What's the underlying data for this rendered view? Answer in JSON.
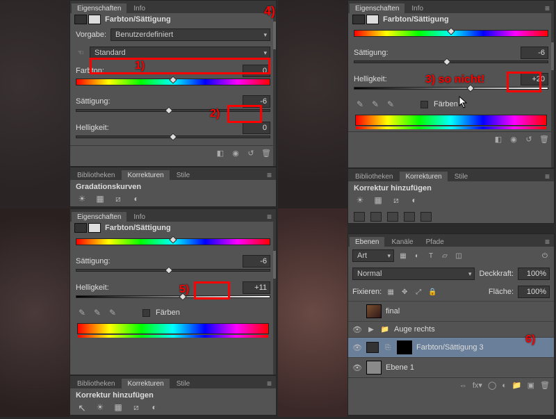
{
  "annotations": {
    "a1": "1)",
    "a2": "2)",
    "a3": "3) so nicht!",
    "a4": "4)",
    "a5": "5)",
    "a6": "6)"
  },
  "tabs": {
    "eigenschaften": "Eigenschaften",
    "info": "Info",
    "bibliotheken": "Bibliotheken",
    "korrekturen": "Korrekturen",
    "stile": "Stile",
    "ebenen": "Ebenen",
    "kanaele": "Kanäle",
    "pfade": "Pfade"
  },
  "hs": {
    "title": "Farbton/Sättigung",
    "preset_label": "Vorgabe:",
    "preset_value": "Benutzerdefiniert",
    "range_value": "Standard",
    "hue_label": "Farbton:",
    "sat_label": "Sättigung:",
    "light_label": "Helligkeit:",
    "colorize": "Färben"
  },
  "panel1": {
    "hue": "0",
    "sat": "-6",
    "light": "0"
  },
  "panel2": {
    "sat": "-6",
    "light": "+20"
  },
  "panel3": {
    "sat": "-6",
    "light": "+11"
  },
  "curves": {
    "title": "Gradationskurven"
  },
  "addadj": {
    "title": "Korrektur hinzufügen"
  },
  "layers": {
    "filter": "Art",
    "blend": "Normal",
    "opacity_label": "Deckkraft:",
    "opacity": "100%",
    "lock_label": "Fixieren:",
    "fill_label": "Fläche:",
    "fill": "100%",
    "items": [
      {
        "name": "final"
      },
      {
        "name": "Auge rechts"
      },
      {
        "name": "Farbton/Sättigung 3"
      },
      {
        "name": "Ebene 1"
      }
    ]
  }
}
